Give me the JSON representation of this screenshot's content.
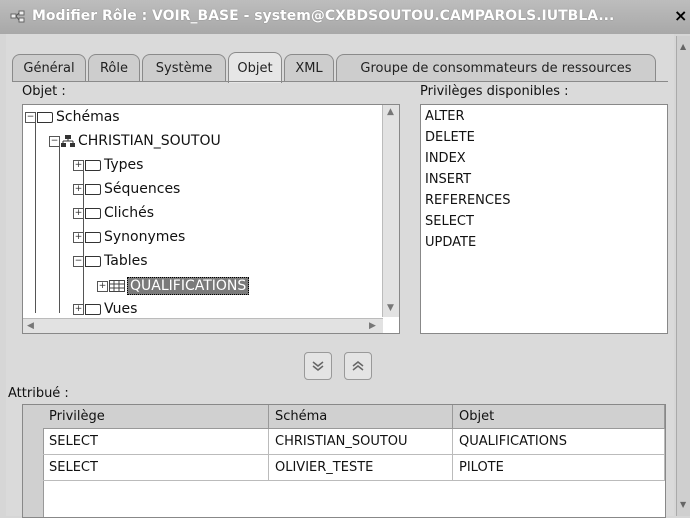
{
  "window": {
    "title": "Modifier Rôle : VOIR_BASE - system@CXBDSOUTOU.CAMPAROLS.IUTBLA...",
    "close_label": "×"
  },
  "tabs": [
    {
      "label": "Général"
    },
    {
      "label": "Rôle"
    },
    {
      "label": "Système"
    },
    {
      "label": "Objet",
      "active": true
    },
    {
      "label": "XML"
    },
    {
      "label": "Groupe de consommateurs de ressources"
    }
  ],
  "objet_label": "Objet :",
  "tree": {
    "items": [
      {
        "label": "Schémas"
      },
      {
        "label": "CHRISTIAN_SOUTOU"
      },
      {
        "label": "Types"
      },
      {
        "label": "Séquences"
      },
      {
        "label": "Clichés"
      },
      {
        "label": "Synonymes"
      },
      {
        "label": "Tables"
      },
      {
        "label": "QUALIFICATIONS",
        "selected": true
      },
      {
        "label": "Vues"
      }
    ]
  },
  "privileges": {
    "label": "Privilèges disponibles :",
    "items": [
      "ALTER",
      "DELETE",
      "INDEX",
      "INSERT",
      "REFERENCES",
      "SELECT",
      "UPDATE"
    ]
  },
  "buttons": {
    "move_down_icon": "chevron-double-down-icon",
    "move_up_icon": "chevron-double-up-icon"
  },
  "attribue": {
    "label": "Attribué :",
    "columns": [
      "Privilège",
      "Schéma",
      "Objet"
    ],
    "rows": [
      [
        "SELECT",
        "CHRISTIAN_SOUTOU",
        "QUALIFICATIONS"
      ],
      [
        "SELECT",
        "OLIVIER_TESTE",
        "PILOTE"
      ]
    ]
  }
}
